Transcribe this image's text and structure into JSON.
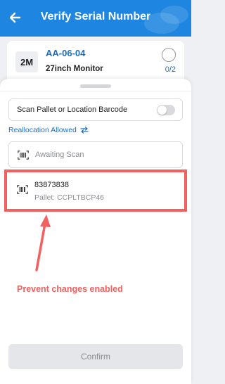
{
  "header": {
    "title": "Verify Serial Number",
    "back_icon": "arrow-left-icon",
    "color": "#1e86e0"
  },
  "task": {
    "quantity": "2M",
    "location": "AA-06-04",
    "item": "27inch Monitor",
    "progress": "0/2"
  },
  "sheet": {
    "scan_toggle_label": "Scan Pallet or Location Barcode",
    "scan_toggle_on": false,
    "reallocation_label": "Reallocation Allowed",
    "reallocation_icon": "swap-arrows-icon",
    "awaiting_text": "Awaiting Scan",
    "scanned": {
      "serial": "83873838",
      "pallet": "Pallet: CCPLTBCP46"
    },
    "confirm_label": "Confirm",
    "confirm_enabled": false
  },
  "annotation": {
    "text": "Prevent changes enabled",
    "color": "#f2605f"
  }
}
